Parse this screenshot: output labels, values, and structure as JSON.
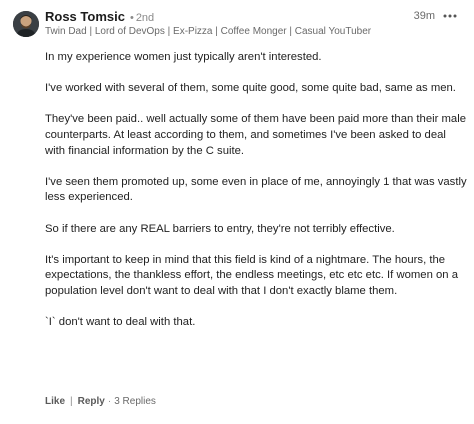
{
  "author": {
    "name": "Ross Tomsic",
    "degree": "2nd",
    "headline": "Twin Dad | Lord of DevOps | Ex-Pizza | Coffee Monger | Casual YouTuber"
  },
  "timestamp": "39m",
  "more_icon": "ellipsis-icon",
  "comment": {
    "paragraphs": [
      "In my experience women just typically aren't interested.",
      "I've worked with several of them, some quite good, some quite bad, same as men.",
      "They've been paid.. well actually some of them have been paid more than their male counterparts. At least according to them, and sometimes I've been asked to deal with financial information by the C suite.",
      "I've seen them promoted up, some even in place of me, annoyingly 1 that was vastly less experienced.",
      "So if there are any REAL barriers to entry, they're not terribly effective.",
      "It's important to keep in mind that this field is kind of a nightmare. The hours, the expectations, the thankless effort, the endless meetings, etc etc etc. If women on a population level don't want to deal with that I don't exactly blame them.",
      "`I` don't want to deal with that."
    ]
  },
  "actions": {
    "like_label": "Like",
    "reply_label": "Reply",
    "replies_count": "3 Replies"
  },
  "colors": {
    "text": "#222222",
    "muted": "#6a6a6a",
    "background": "#ffffff"
  }
}
